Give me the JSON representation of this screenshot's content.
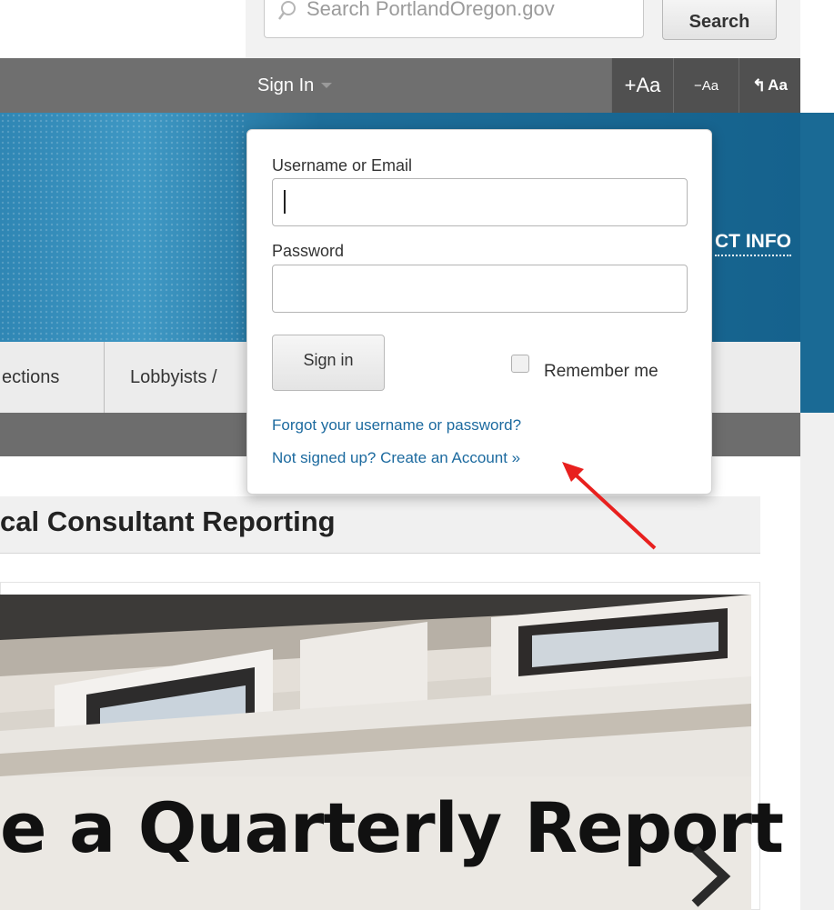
{
  "search": {
    "placeholder": "Search PortlandOregon.gov",
    "button_label": "Search"
  },
  "utility_bar": {
    "sign_in_label": "Sign In",
    "font_increase_label": "+Aa",
    "font_decrease_label": "−Aa",
    "font_reset_label": "Aa"
  },
  "banner": {
    "contact_info": "CT INFO"
  },
  "nav": {
    "items": [
      {
        "label": "ections"
      },
      {
        "label": "Lobbyists /"
      }
    ]
  },
  "page": {
    "title": "cal Consultant Reporting"
  },
  "hero": {
    "caption": "e a Quarterly Report"
  },
  "login": {
    "username_label": "Username or Email",
    "username_value": "",
    "password_label": "Password",
    "password_value": "",
    "sign_in_button": "Sign in",
    "remember_me_label": "Remember me",
    "remember_me_checked": false,
    "forgot_link": "Forgot your username or password?",
    "create_account_link": "Not signed up? Create an Account »"
  },
  "colors": {
    "banner_blue": "#15628d",
    "utility_gray": "#6f6f6f",
    "link_blue": "#1c6a9f",
    "annotation_red": "#e8201e"
  },
  "icons": {
    "search": "search-icon",
    "next": "chevron-right-icon",
    "caret": "chevron-down-icon"
  }
}
